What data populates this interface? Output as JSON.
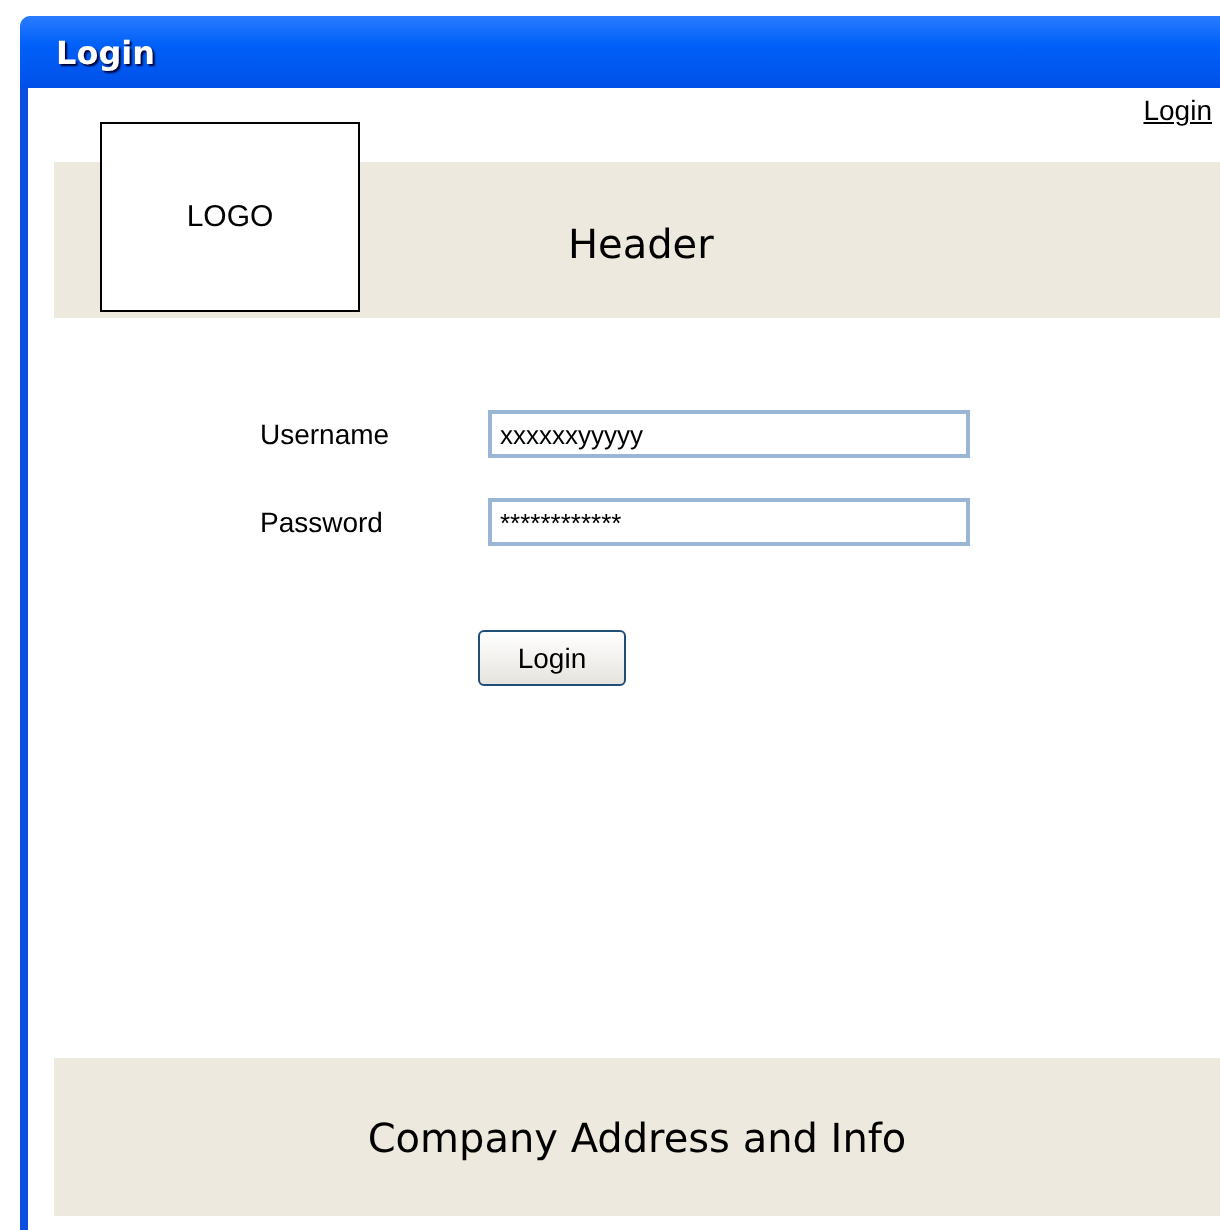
{
  "window": {
    "title": "Login"
  },
  "top_link": "Login",
  "header": {
    "logo": "LOGO",
    "title": "Header"
  },
  "form": {
    "fields": [
      {
        "label": "Username",
        "value": "xxxxxxyyyyy"
      },
      {
        "label": "Password",
        "value": "************"
      }
    ],
    "button": "Login"
  },
  "footer": "Company Address and Info"
}
